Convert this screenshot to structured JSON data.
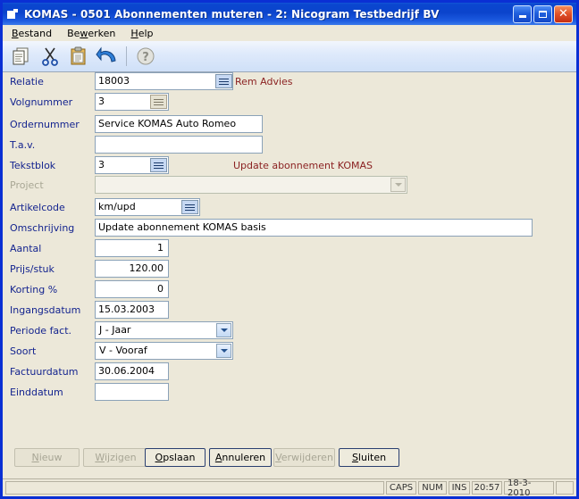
{
  "window": {
    "title": "KOMAS - 0501 Abonnementen muteren - 2: Nicogram Testbedrijf BV",
    "icon": "application-icon",
    "buttons": {
      "minimize": "minimize-button",
      "maximize": "maximize-button",
      "close": "close-button",
      "close_glyph": "✕"
    }
  },
  "menubar": {
    "items": [
      {
        "label": "Bestand",
        "accel": "B"
      },
      {
        "label": "Bewerken",
        "accel": "w"
      },
      {
        "label": "Help",
        "accel": "H"
      }
    ]
  },
  "toolbar": {
    "items": [
      {
        "name": "copy-icon",
        "label": "Kopieren"
      },
      {
        "name": "cut-icon",
        "label": "Knippen"
      },
      {
        "name": "paste-icon",
        "label": "Plakken"
      },
      {
        "name": "undo-icon",
        "label": "Ongedaan maken"
      },
      {
        "name": "help-icon",
        "label": "Help"
      }
    ]
  },
  "form": {
    "fields": [
      {
        "key": "relatie",
        "label": "Relatie",
        "value": "18003",
        "note": "Rem Advies"
      },
      {
        "key": "volgnummer",
        "label": "Volgnummer",
        "value": "3",
        "note": ""
      },
      {
        "key": "ordernummer",
        "label": "Ordernummer",
        "value": "Service KOMAS Auto Romeo",
        "note": ""
      },
      {
        "key": "tav",
        "label": "T.a.v.",
        "value": "",
        "note": ""
      },
      {
        "key": "tekstblok",
        "label": "Tekstblok",
        "value": "3",
        "note": "Update abonnement KOMAS"
      },
      {
        "key": "project",
        "label": "Project",
        "value": "",
        "note": ""
      },
      {
        "key": "artikelcode",
        "label": "Artikelcode",
        "value": "km/upd",
        "note": ""
      },
      {
        "key": "omschrijving",
        "label": "Omschrijving",
        "value": "Update abonnement KOMAS basis",
        "note": ""
      },
      {
        "key": "aantal",
        "label": "Aantal",
        "value": "1",
        "note": ""
      },
      {
        "key": "prijs",
        "label": "Prijs/stuk",
        "value": "120.00",
        "note": ""
      },
      {
        "key": "korting",
        "label": "Korting %",
        "value": "0",
        "note": ""
      },
      {
        "key": "ingangsdatum",
        "label": "Ingangsdatum",
        "value": "15.03.2003",
        "note": ""
      },
      {
        "key": "periode",
        "label": "Periode fact.",
        "value": "J - Jaar",
        "note": ""
      },
      {
        "key": "soort",
        "label": "Soort",
        "value": "V - Vooraf",
        "note": ""
      },
      {
        "key": "factuurdatum",
        "label": "Factuurdatum",
        "value": "30.06.2004",
        "note": ""
      },
      {
        "key": "einddatum",
        "label": "Einddatum",
        "value": "",
        "note": ""
      }
    ]
  },
  "actions": [
    {
      "key": "nieuw",
      "label": "Nieuw",
      "accel": "N",
      "rest": "ieuw",
      "state": "disabled"
    },
    {
      "key": "wijzigen",
      "label": "Wijzigen",
      "accel": "W",
      "rest": "ijzigen",
      "state": "disabled"
    },
    {
      "key": "opslaan",
      "label": "Opslaan",
      "accel": "O",
      "rest": "pslaan",
      "state": "enabled"
    },
    {
      "key": "annuleren",
      "label": "Annuleren",
      "accel": "A",
      "rest": "nnuleren",
      "state": "enabled"
    },
    {
      "key": "verwijderen",
      "label": "Verwijderen",
      "accel": "V",
      "rest": "erwijderen",
      "state": "disabled"
    },
    {
      "key": "sluiten",
      "label": "Sluiten",
      "accel": "S",
      "rest": "luiten",
      "state": "enabled"
    }
  ],
  "statusbar": {
    "message": "",
    "cells": [
      "CAPS",
      "NUM",
      "INS",
      "20:57",
      "18-3-2010"
    ]
  },
  "colors": {
    "title_bar": "#0b44cc",
    "window_border": "#0a2fd4",
    "background": "#ece8d9",
    "label": "#14248f",
    "note": "#8b2222",
    "field_border": "#8ba2b8"
  }
}
